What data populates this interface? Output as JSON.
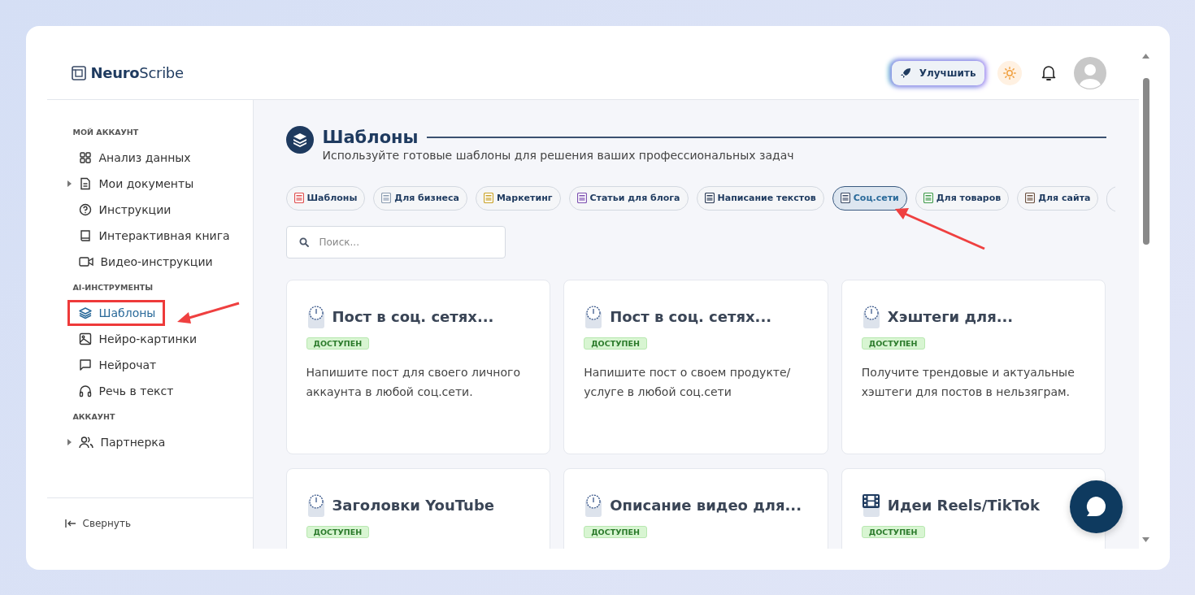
{
  "logo": {
    "bold": "Neuro",
    "light": "Scribe"
  },
  "header": {
    "upgrade_label": "Улучшить"
  },
  "sidebar": {
    "sections": [
      {
        "title": "МОЙ АККАУНТ",
        "items": [
          {
            "label": "Анализ данных",
            "collapsible": false,
            "selected": false
          },
          {
            "label": "Мои документы",
            "collapsible": true,
            "selected": false
          },
          {
            "label": "Инструкции",
            "collapsible": false,
            "selected": false
          },
          {
            "label": "Интерактивная книга",
            "collapsible": false,
            "selected": false
          },
          {
            "label": "Видео-инструкции",
            "collapsible": false,
            "selected": false
          }
        ]
      },
      {
        "title": "AI-ИНСТРУМЕНТЫ",
        "items": [
          {
            "label": "Шаблоны",
            "collapsible": false,
            "selected": true
          },
          {
            "label": "Нейро-картинки",
            "collapsible": false,
            "selected": false
          },
          {
            "label": "Нейрочат",
            "collapsible": false,
            "selected": false
          },
          {
            "label": "Речь в текст",
            "collapsible": false,
            "selected": false
          }
        ]
      },
      {
        "title": "АККАУНТ",
        "items": [
          {
            "label": "Партнерка",
            "collapsible": true,
            "selected": false
          }
        ]
      }
    ],
    "collapse_label": "Свернуть"
  },
  "page": {
    "title": "Шаблоны",
    "subtitle": "Используйте готовые шаблоны для решения ваших профессиональных задач"
  },
  "categories": [
    {
      "label": "Шаблоны",
      "selected": false
    },
    {
      "label": "Для бизнеса",
      "selected": false
    },
    {
      "label": "Маркетинг",
      "selected": false
    },
    {
      "label": "Статьи для блога",
      "selected": false
    },
    {
      "label": "Написание текстов",
      "selected": false
    },
    {
      "label": "Соц.сети",
      "selected": true
    },
    {
      "label": "Для товаров",
      "selected": false
    },
    {
      "label": "Для сайта",
      "selected": false
    }
  ],
  "search": {
    "placeholder": "Поиск..."
  },
  "templates": [
    {
      "title": "Пост в соц. сетях...",
      "kind": "clock",
      "badge": "ДОСТУПЕН",
      "description": "Напишите пост для своего личного аккаунта в любой соц.сети."
    },
    {
      "title": "Пост в соц. сетях...",
      "kind": "clock",
      "badge": "ДОСТУПЕН",
      "description": "Напишите пост о своем продукте/ услуге в любой соц.сети"
    },
    {
      "title": "Хэштеги для...",
      "kind": "clock",
      "badge": "ДОСТУПЕН",
      "description": "Получите трендовые и актуальные хэштеги для постов в нельзяграм."
    },
    {
      "title": "Заголовки YouTube",
      "kind": "clock",
      "badge": "ДОСТУПЕН"
    },
    {
      "title": "Описание видео для...",
      "kind": "clock",
      "badge": "ДОСТУПЕН"
    },
    {
      "title": "Идеи Reels/TikTok",
      "kind": "film",
      "badge": "ДОСТУПЕН"
    }
  ]
}
